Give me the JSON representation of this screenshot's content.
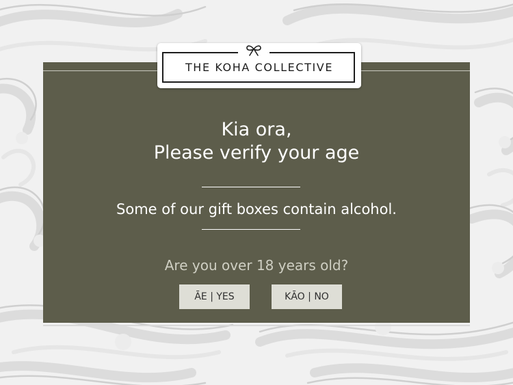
{
  "brand": {
    "name": "THE KOHA COLLECTIVE",
    "logo_icon": "bow-icon"
  },
  "age_gate": {
    "greeting_line1": "Kia ora,",
    "greeting_line2": "Please verify your age",
    "notice": "Some of our gift boxes contain alcohol.",
    "question": "Are you over 18 years old?",
    "yes_label": "ĀE | YES",
    "no_label": "KĀO | NO"
  },
  "colors": {
    "modal_background": "#5d5d4b",
    "page_background": "#f1f1f1",
    "button_background": "#deded6",
    "text_primary": "#ffffff"
  }
}
